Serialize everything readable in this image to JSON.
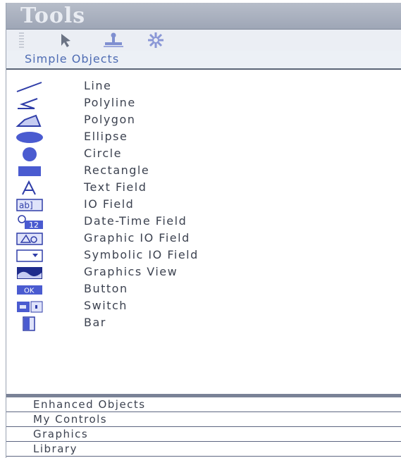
{
  "panel": {
    "title": "Tools"
  },
  "toolbar": {
    "icons": [
      "pointer-icon",
      "stamp-icon",
      "settings-wheel-icon"
    ]
  },
  "section": {
    "label": "Simple Objects"
  },
  "items": [
    {
      "label": "Line",
      "icon": "line-icon"
    },
    {
      "label": "Polyline",
      "icon": "polyline-icon"
    },
    {
      "label": "Polygon",
      "icon": "polygon-icon"
    },
    {
      "label": "Ellipse",
      "icon": "ellipse-icon"
    },
    {
      "label": "Circle",
      "icon": "circle-icon"
    },
    {
      "label": "Rectangle",
      "icon": "rectangle-icon"
    },
    {
      "label": "Text Field",
      "icon": "text-field-icon"
    },
    {
      "label": "IO Field",
      "icon": "io-field-icon"
    },
    {
      "label": "Date-Time Field",
      "icon": "date-time-field-icon"
    },
    {
      "label": "Graphic IO Field",
      "icon": "graphic-io-field-icon"
    },
    {
      "label": "Symbolic IO Field",
      "icon": "symbolic-io-field-icon"
    },
    {
      "label": "Graphics View",
      "icon": "graphics-view-icon"
    },
    {
      "label": "Button",
      "icon": "button-icon"
    },
    {
      "label": "Switch",
      "icon": "switch-icon"
    },
    {
      "label": "Bar",
      "icon": "bar-icon"
    }
  ],
  "icon_text": {
    "io": "ab]",
    "date": "12",
    "button": "OK"
  },
  "footer": {
    "tabs": [
      "Enhanced Objects",
      "My Controls",
      "Graphics",
      "Library"
    ]
  },
  "colors": {
    "title_bg": "#9ea6b6",
    "accent_blue": "#4e6cb3",
    "icon_blue": "#4a5bd0",
    "separator": "#5b6577"
  }
}
